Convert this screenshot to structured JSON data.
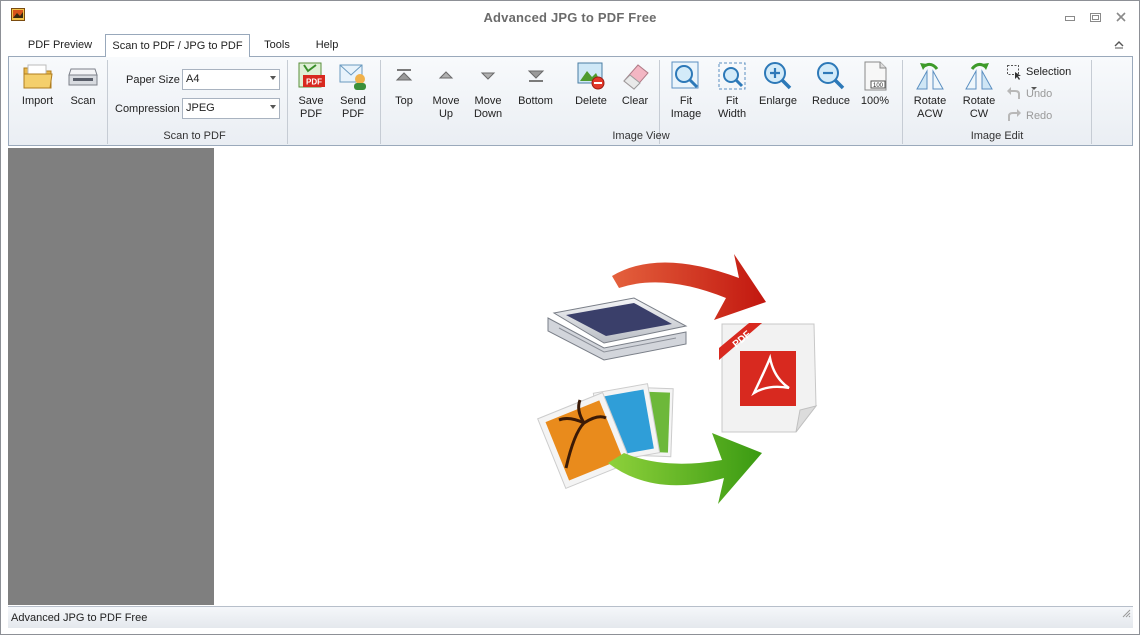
{
  "window": {
    "title": "Advanced JPG to PDF Free"
  },
  "tabs": [
    {
      "label": "PDF Preview",
      "active": false
    },
    {
      "label": "Scan to PDF / JPG to PDF",
      "active": true
    },
    {
      "label": "Tools",
      "active": false
    },
    {
      "label": "Help",
      "active": false
    }
  ],
  "ribbon": {
    "scan_group": {
      "label": "Scan to PDF",
      "import": "Import",
      "scan": "Scan",
      "paper_size_label": "Paper Size",
      "paper_size_value": "A4",
      "compression_label": "Compression",
      "compression_value": "JPEG",
      "save_pdf": [
        "Save",
        "PDF"
      ],
      "send_pdf": [
        "Send",
        "PDF"
      ]
    },
    "view_group": {
      "label": "Image View",
      "top": "Top",
      "move_up": [
        "Move",
        "Up"
      ],
      "move_down": [
        "Move",
        "Down"
      ],
      "bottom": "Bottom",
      "delete": "Delete",
      "clear": "Clear",
      "fit_image": [
        "Fit",
        "Image"
      ],
      "fit_width": [
        "Fit",
        "Width"
      ],
      "enlarge": "Enlarge",
      "reduce": "Reduce",
      "zoom100": "100%",
      "zoom_icon_text": "100"
    },
    "edit_group": {
      "label": "Image Edit",
      "rotate_acw": [
        "Rotate",
        "ACW"
      ],
      "rotate_cw": [
        "Rotate",
        "CW"
      ],
      "selection": "Selection",
      "undo": "Undo",
      "redo": "Redo"
    }
  },
  "splash": {
    "pdf_badge": "PDF"
  },
  "status": {
    "text": "Advanced JPG to PDF Free"
  },
  "colors": {
    "accent": "#d8291f",
    "green": "#4caf1a",
    "panel_gray": "#7f7f7f"
  }
}
